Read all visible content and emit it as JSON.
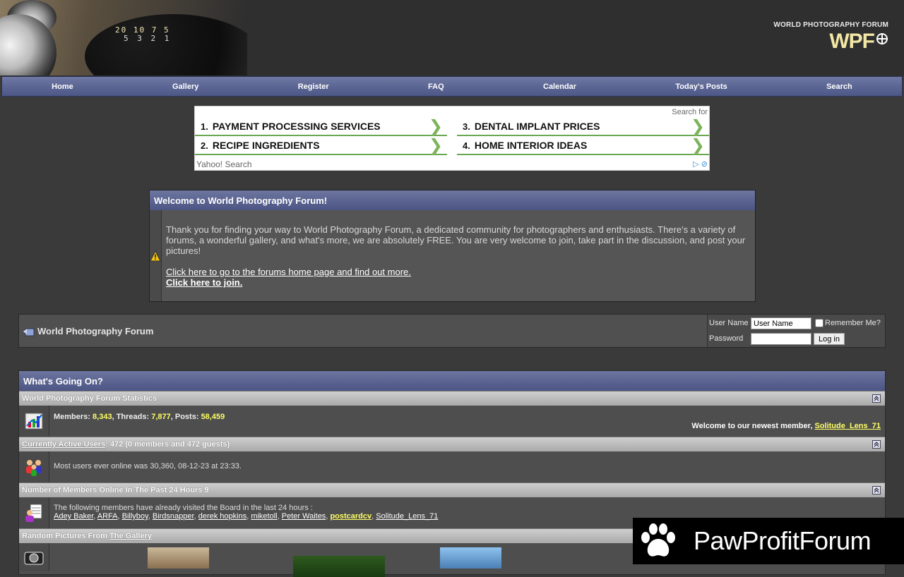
{
  "header": {
    "brand_sub": "WORLD PHOTOGRAPHY FORUM",
    "brand_main": "WPF",
    "camera_nums": "20 10 7 5",
    "camera_nums2": "5 3 2 1"
  },
  "nav": [
    "Home",
    "Gallery",
    "Register",
    "FAQ",
    "Calendar",
    "Today's Posts",
    "Search"
  ],
  "ad": {
    "search_for": "Search for",
    "items": [
      {
        "n": "1.",
        "label": "PAYMENT PROCESSING SERVICES"
      },
      {
        "n": "2.",
        "label": "RECIPE INGREDIENTS"
      },
      {
        "n": "3.",
        "label": "DENTAL IMPLANT PRICES"
      },
      {
        "n": "4.",
        "label": "HOME INTERIOR IDEAS"
      }
    ],
    "footer": "Yahoo! Search"
  },
  "welcome": {
    "title": "Welcome to World Photography Forum!",
    "text": "Thank you for finding your way to World Photography Forum, a dedicated community for photographers and enthusiasts. There's a variety of forums, a wonderful gallery, and what's more, we are absolutely FREE. You are very welcome to join, take part in the discussion, and post your pictures!",
    "link_home": "Click here to go to the forums home page and find out more.",
    "link_join": "Click here to join."
  },
  "breadcrumb": {
    "title": "World Photography Forum"
  },
  "login": {
    "username_label": "User Name",
    "username_value": "User Name",
    "password_label": "Password",
    "remember_label": "Remember Me?",
    "button": "Log in"
  },
  "wgo": {
    "title": "What's Going On?",
    "stats": {
      "head": "World Photography Forum Statistics",
      "members_label": "Members:",
      "members": "8,343",
      "threads_label": "Threads:",
      "threads": "7,877",
      "posts_label": "Posts:",
      "posts": "58,459",
      "newest_label": "Welcome to our newest member,",
      "newest": "Solitude_Lens_71"
    },
    "active": {
      "head_link": "Currently Active Users",
      "head_rest": ": 472 (0 members and 472 guests)",
      "text": "Most users ever online was 30,360, 08-12-23 at 23:33."
    },
    "online24": {
      "head": "Number of Members Online In The Past 24 Hours 9",
      "intro": "The following members have already visited the Board in the last 24 hours :",
      "members": [
        "Adey Baker",
        "ARFA",
        "Billyboy",
        "Birdsnapper",
        "derek hopkins",
        "miketoll",
        "Peter Waites",
        "postcardcv",
        "Solitude_Lens_71"
      ],
      "highlight_index": 7
    },
    "gallery": {
      "head_pre": "Random Pictures From ",
      "head_link": "The Gallery"
    }
  },
  "watermark": {
    "text": "PawProfitForum"
  },
  "colors": {
    "accent_yellow": "#ffff66",
    "nav_blue": "#5c6694",
    "ad_green": "#6aa84f"
  }
}
